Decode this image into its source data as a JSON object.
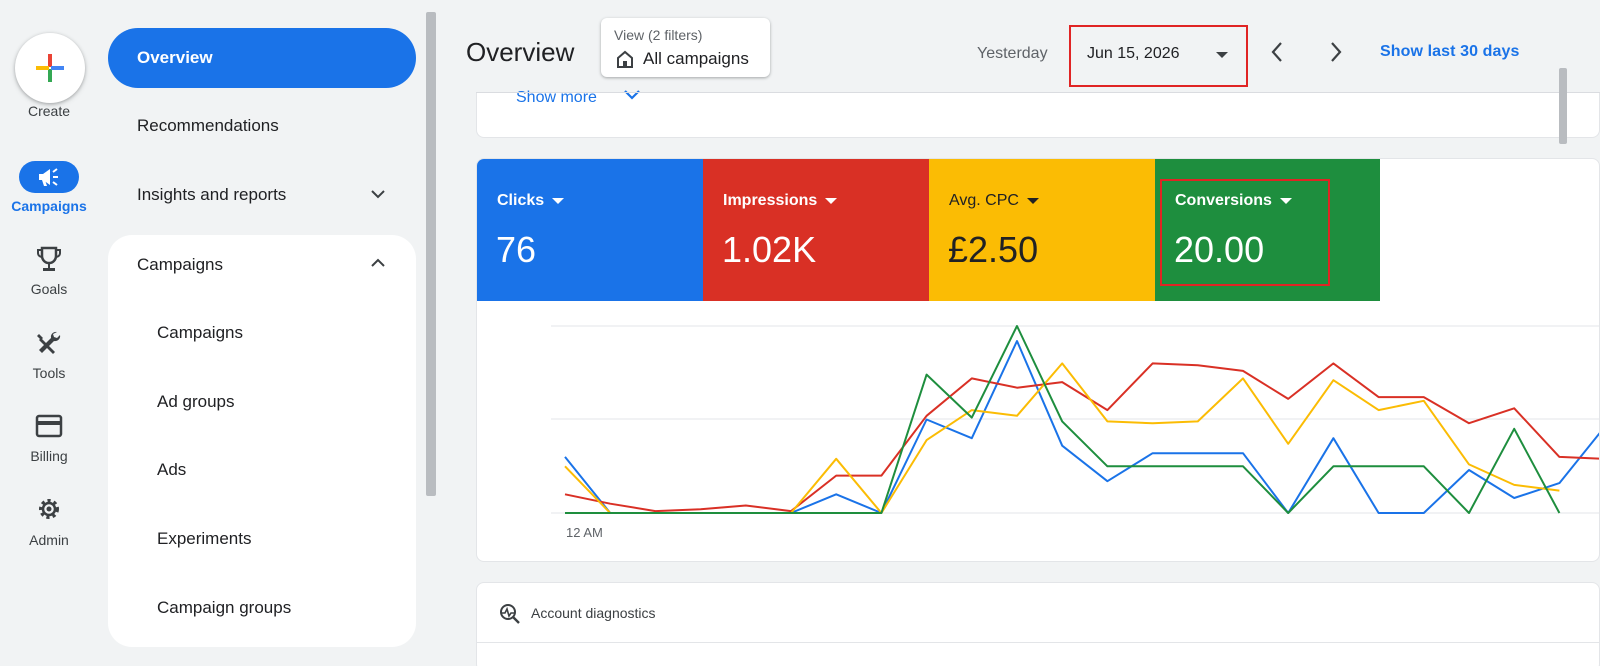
{
  "rail": {
    "create_label": "Create",
    "items": [
      {
        "label": "Campaigns",
        "icon": "megaphone-icon"
      },
      {
        "label": "Goals",
        "icon": "trophy-icon"
      },
      {
        "label": "Tools",
        "icon": "tools-icon"
      },
      {
        "label": "Billing",
        "icon": "credit-card-icon"
      },
      {
        "label": "Admin",
        "icon": "gear-icon"
      }
    ]
  },
  "nav": {
    "items": [
      {
        "label": "Overview"
      },
      {
        "label": "Recommendations"
      },
      {
        "label": "Insights and reports"
      }
    ],
    "group_label": "Campaigns",
    "sub_items": [
      {
        "label": "Campaigns"
      },
      {
        "label": "Ad groups"
      },
      {
        "label": "Ads"
      },
      {
        "label": "Experiments"
      },
      {
        "label": "Campaign groups"
      }
    ]
  },
  "header": {
    "title": "Overview",
    "view_label": "View (2 filters)",
    "view_value": "All campaigns",
    "yesterday": "Yesterday",
    "date": "Jun 15, 2026",
    "show_last": "Show last 30 days"
  },
  "card_top": {
    "show_more": "Show more"
  },
  "metrics": [
    {
      "label": "Clicks",
      "value": "76",
      "color": "#1a73e8"
    },
    {
      "label": "Impressions",
      "value": "1.02K",
      "color": "#d93025"
    },
    {
      "label": "Avg. CPC",
      "value": "£2.50",
      "color": "#fbbc04"
    },
    {
      "label": "Conversions",
      "value": "20.00",
      "color": "#1e8e3e"
    }
  ],
  "chart_data": {
    "type": "line",
    "xlabel_first_tick": "12 AM",
    "grid": true,
    "series": [
      {
        "color": "#1a73e8",
        "values": [
          30,
          0,
          0,
          0,
          0,
          0,
          10,
          0,
          50,
          40,
          92,
          36,
          17,
          32,
          32,
          32,
          0,
          40,
          0,
          0,
          23,
          8,
          16,
          46,
          19,
          8,
          29
        ]
      },
      {
        "color": "#d93025",
        "values": [
          10,
          5,
          1,
          2,
          4,
          1,
          20,
          20,
          52,
          72,
          67,
          70,
          55,
          80,
          79,
          76,
          61,
          80,
          62,
          62,
          48,
          56,
          30,
          29
        ]
      },
      {
        "color": "#fbbc04",
        "values": [
          25,
          0,
          0,
          0,
          0,
          0,
          29,
          0,
          39,
          55,
          52,
          80,
          49,
          48,
          49,
          72,
          37,
          71,
          55,
          60,
          26,
          15,
          12
        ]
      },
      {
        "color": "#1e8e3e",
        "values": [
          0,
          0,
          0,
          0,
          0,
          0,
          0,
          0,
          74,
          51,
          100,
          49,
          25,
          25,
          25,
          25,
          0,
          25,
          25,
          25,
          0,
          45,
          0
        ]
      }
    ]
  },
  "diagnostics": {
    "label": "Account diagnostics"
  }
}
